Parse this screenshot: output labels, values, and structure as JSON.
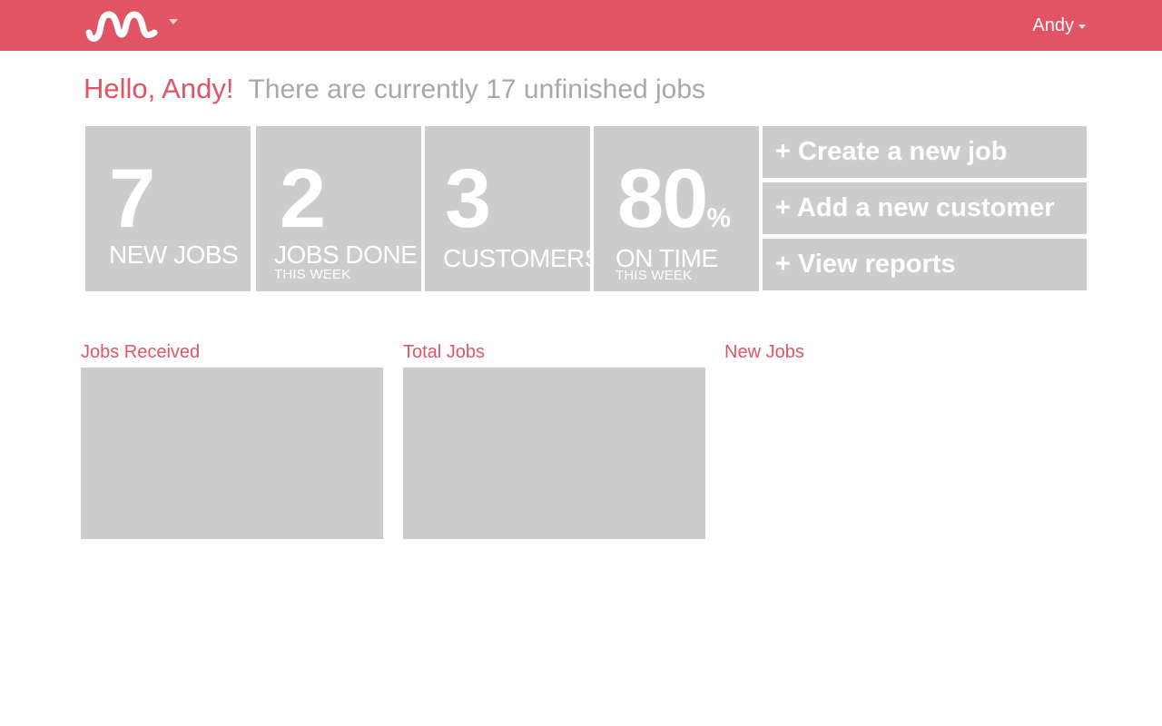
{
  "colors": {
    "brand": "#e05465",
    "tile": "#cccccc",
    "muted_text": "#a8a8a8"
  },
  "header": {
    "logo_icon": "squiggle-logo",
    "user_name": "Andy"
  },
  "greeting": {
    "hello": "Hello, Andy!",
    "status": "There are currently 17 unfinished jobs"
  },
  "stats": [
    {
      "value": "7",
      "label": "NEW JOBS",
      "sublabel": ""
    },
    {
      "value": "2",
      "label": "JOBS DONE",
      "sublabel": "THIS WEEK"
    },
    {
      "value": "3",
      "label": "CUSTOMERS",
      "sublabel": ""
    },
    {
      "value": "80",
      "unit": "%",
      "label": "ON TIME",
      "sublabel": "THIS WEEK"
    }
  ],
  "actions": [
    {
      "label": "+ Create a new job"
    },
    {
      "label": "+ Add a new customer"
    },
    {
      "label": "+ View reports"
    }
  ],
  "sections": [
    {
      "title": "Jobs Received"
    },
    {
      "title": "Total Jobs"
    },
    {
      "title": "New Jobs"
    }
  ]
}
